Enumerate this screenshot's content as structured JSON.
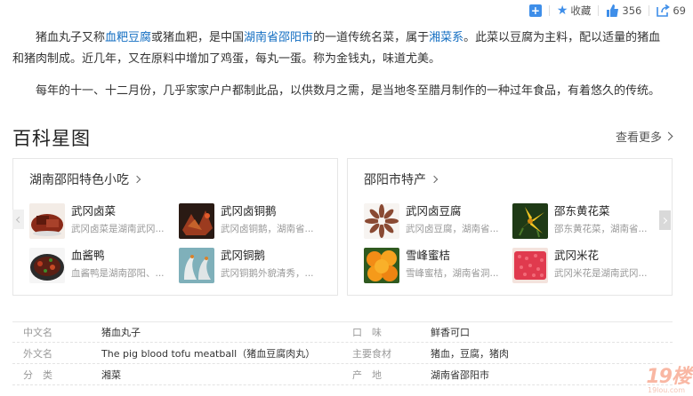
{
  "toolbar": {
    "add_icon": "plus-square-icon",
    "favorite_label": "收藏",
    "like_count": "356",
    "share_count": "69"
  },
  "intro": {
    "p1": {
      "t1": "猪血丸子又称",
      "link1": "血粑豆腐",
      "t2": "或猪血粑，是中国",
      "link2": "湖南省邵阳市",
      "t3": "的一道传统名菜，属于",
      "link3": "湘菜系",
      "t4": "。此菜以豆腐为主料，配以适量的猪血和猪肉制成。近几年，又在原料中增加了鸡蛋，每丸一蛋。称为金钱丸，味道尤美。"
    },
    "p2": "每年的十一、十二月份，几乎家家户户都制此品，以供数月之需，是当地冬至腊月制作的一种过年食品，有着悠久的传统。"
  },
  "section": {
    "title": "百科星图",
    "more": "查看更多"
  },
  "panels": [
    {
      "title": "湖南邵阳特色小吃",
      "items": [
        {
          "name": "武冈卤菜",
          "desc": "武冈卤菜是湖南武冈..."
        },
        {
          "name": "武冈卤铜鹅",
          "desc": "武冈卤铜鹅，湖南省..."
        },
        {
          "name": "血酱鸭",
          "desc": "血酱鸭是湖南邵阳、..."
        },
        {
          "name": "武冈铜鹅",
          "desc": "武冈铜鹅外貌清秀，..."
        }
      ]
    },
    {
      "title": "邵阳市特产",
      "items": [
        {
          "name": "武冈卤豆腐",
          "desc": "武冈卤豆腐，湖南省..."
        },
        {
          "name": "邵东黄花菜",
          "desc": "邵东黄花菜，湖南省..."
        },
        {
          "name": "雪峰蜜桔",
          "desc": "雪峰蜜桔，湖南省洞..."
        },
        {
          "name": "武冈米花",
          "desc": "武冈米花是湖南武冈..."
        }
      ]
    }
  ],
  "info": {
    "rows": [
      {
        "k1": "中文名",
        "v1": "猪血丸子",
        "k2": "口　味",
        "v2": "鲜香可口"
      },
      {
        "k1": "外文名",
        "v1": "The pig blood tofu meatball（猪血豆腐肉丸）",
        "k2": "主要食材",
        "v2": "猪血，豆腐，猪肉"
      },
      {
        "k1": "分　类",
        "v1": "湘菜",
        "k2": "产　地",
        "v2": "湖南省邵阳市"
      }
    ]
  },
  "watermark": {
    "main": "19楼",
    "sub": "19lou.com"
  },
  "colors": {
    "link": "#136ec2",
    "accent": "#3e8ee9"
  }
}
